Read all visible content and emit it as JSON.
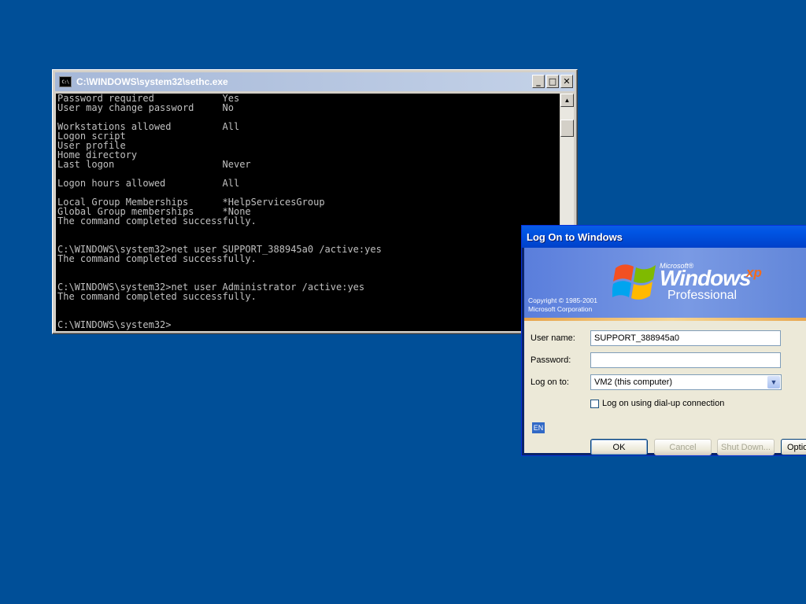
{
  "desktop": {
    "background_color": "#004f98"
  },
  "console": {
    "title": "C:\\WINDOWS\\system32\\sethc.exe",
    "icon": "C:\\",
    "buttons": {
      "minimize": "_",
      "maximize": "□",
      "close": "✕"
    },
    "lines": [
      "Password required            Yes",
      "User may change password     No",
      "",
      "Workstations allowed         All",
      "Logon script",
      "User profile",
      "Home directory",
      "Last logon                   Never",
      "",
      "Logon hours allowed          All",
      "",
      "Local Group Memberships      *HelpServicesGroup",
      "Global Group memberships     *None",
      "The command completed successfully.",
      "",
      "",
      "C:\\WINDOWS\\system32>net user SUPPORT_388945a0 /active:yes",
      "The command completed successfully.",
      "",
      "",
      "C:\\WINDOWS\\system32>net user Administrator /active:yes",
      "The command completed successfully.",
      "",
      "",
      "C:\\WINDOWS\\system32>"
    ]
  },
  "logon": {
    "title": "Log On to Windows",
    "banner": {
      "microsoft": "Microsoft®",
      "windows": "Windows",
      "xp": "xp",
      "edition": "Professional",
      "copyright_line1": "Copyright © 1985-2001",
      "copyright_line2": "Microsoft Corporation"
    },
    "user_name_label": "User name:",
    "user_name_value": "SUPPORT_388945a0",
    "password_label": "Password:",
    "password_value": "",
    "logon_to_label": "Log on to:",
    "logon_to_value": "VM2 (this computer)",
    "dialup_label": "Log on using dial-up connection",
    "dialup_checked": false,
    "language": "EN",
    "ok_label": "OK",
    "cancel_label": "Cancel",
    "shutdown_label": "Shut Down...",
    "options_label": "Options"
  }
}
